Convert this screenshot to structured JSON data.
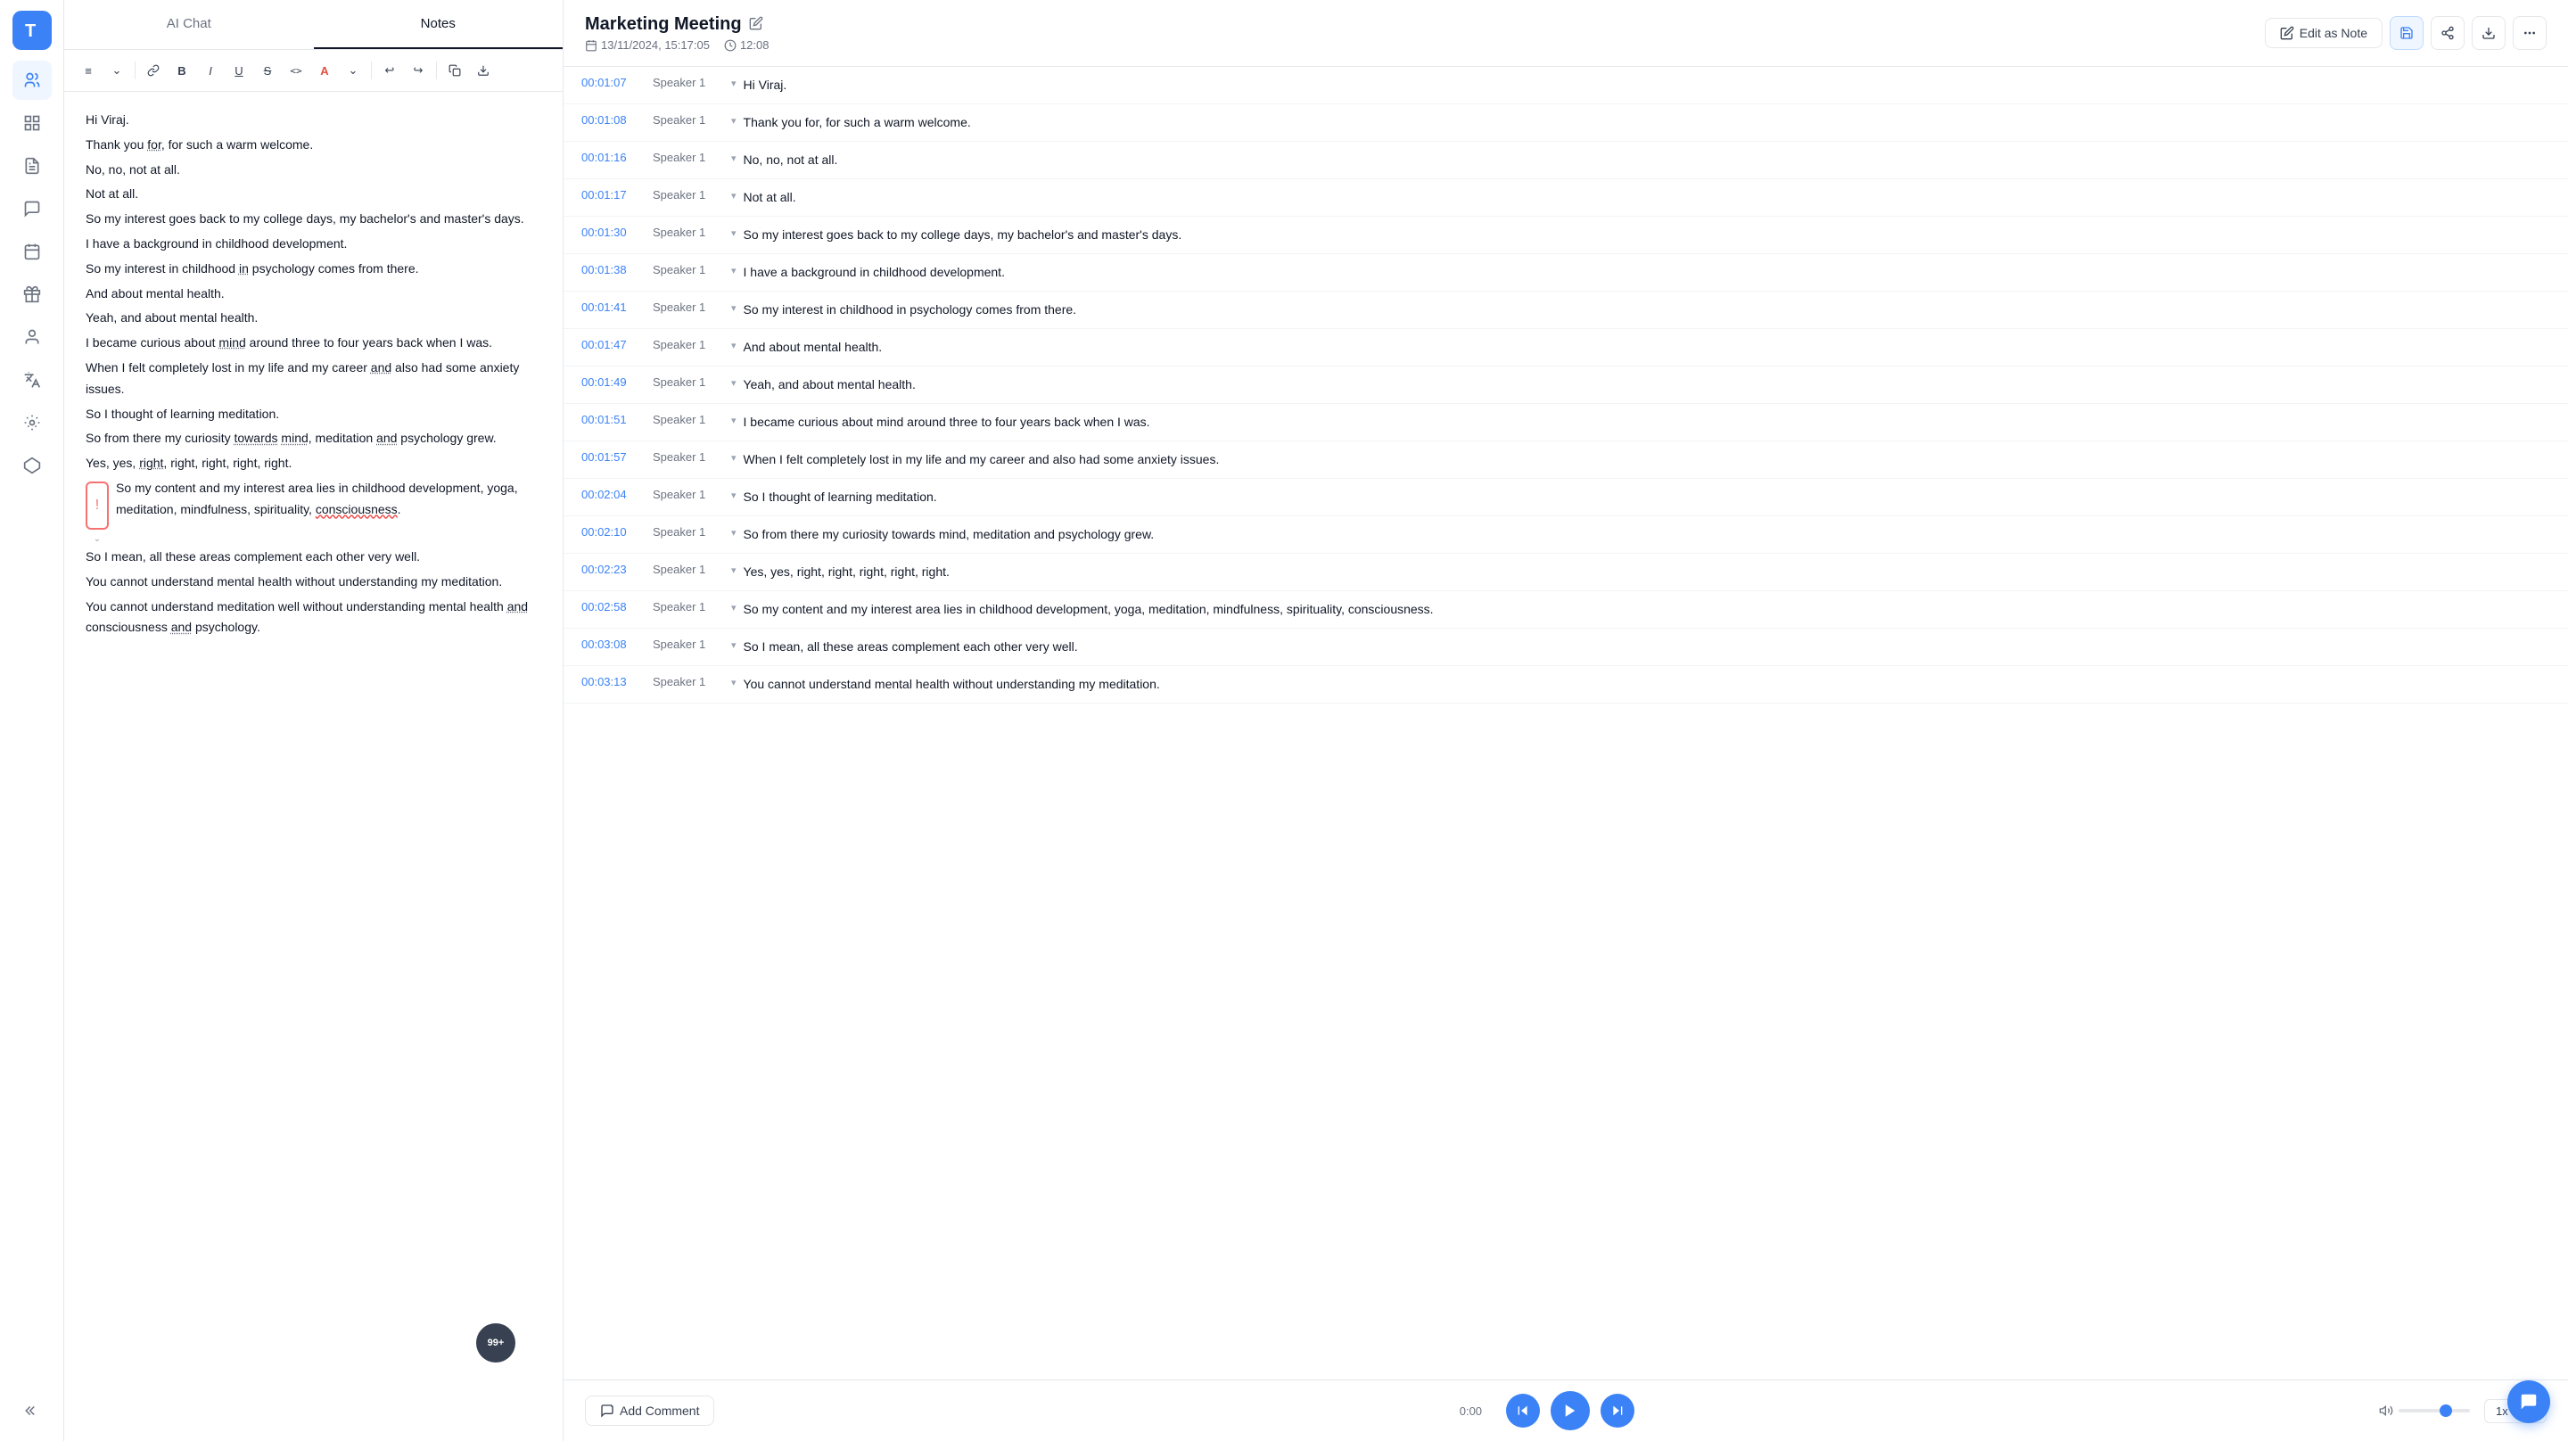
{
  "app": {
    "title": "Marketing Meeting"
  },
  "sidebar": {
    "logo_letter": "T",
    "items": [
      {
        "name": "users-icon",
        "label": "Users"
      },
      {
        "name": "grid-icon",
        "label": "Grid"
      },
      {
        "name": "document-icon",
        "label": "Document"
      },
      {
        "name": "chat-icon",
        "label": "Chat"
      },
      {
        "name": "calendar-icon",
        "label": "Calendar"
      },
      {
        "name": "gift-icon",
        "label": "Gift"
      },
      {
        "name": "person-icon",
        "label": "Person"
      },
      {
        "name": "translate-icon",
        "label": "Translate"
      },
      {
        "name": "tool-icon",
        "label": "Tool"
      },
      {
        "name": "diamond-icon",
        "label": "Diamond"
      }
    ]
  },
  "tabs": {
    "ai_chat": "AI Chat",
    "notes": "Notes"
  },
  "toolbar": {
    "buttons": [
      "≡",
      "⌄",
      "🔗",
      "B",
      "I",
      "U",
      "S",
      "<>",
      "A",
      "⌄",
      "↩",
      "↪",
      "⎘",
      "⬇"
    ]
  },
  "editor": {
    "lines": [
      "Hi Viraj.",
      "Thank you for, for such a warm welcome.",
      "No, no, not at all.",
      "Not at all.",
      "So my interest goes back to my college days, my bachelor's and master's days.",
      "I have a background in childhood development.",
      "So my interest in childhood in psychology comes from there.",
      "And about mental health.",
      "Yeah, and about mental health.",
      "I became curious about mind around three to four years back when I was.",
      "When I felt completely lost in my life and my career and also had some anxiety issues.",
      "So I thought of learning meditation.",
      "So from there my curiosity towards mind, meditation and psychology grew.",
      "Yes, yes, right, right, right, right, right.",
      "So my content and my interest area lies in childhood development, yoga, meditation, mindfulness, spirituality, consciousness.",
      "So I mean, all these areas complement each other very well.",
      "You cannot understand mental health without understanding my meditation.",
      "You cannot understand meditation well without understanding mental health and consciousness and psychology."
    ]
  },
  "meeting": {
    "title": "Marketing Meeting",
    "date": "13/11/2024, 15:17:05",
    "duration": "12:08",
    "edit_note_label": "Edit as Note"
  },
  "transcript": [
    {
      "time": "00:01:07",
      "speaker": "Speaker 1",
      "text": "Hi Viraj."
    },
    {
      "time": "00:01:08",
      "speaker": "Speaker 1",
      "text": "Thank you for, for such a warm welcome."
    },
    {
      "time": "00:01:16",
      "speaker": "Speaker 1",
      "text": "No, no, not at all."
    },
    {
      "time": "00:01:17",
      "speaker": "Speaker 1",
      "text": "Not at all."
    },
    {
      "time": "00:01:30",
      "speaker": "Speaker 1",
      "text": "So my interest goes back to my college days, my bachelor's and master's days."
    },
    {
      "time": "00:01:38",
      "speaker": "Speaker 1",
      "text": "I have a background in childhood development."
    },
    {
      "time": "00:01:41",
      "speaker": "Speaker 1",
      "text": "So my interest in childhood in psychology comes from there."
    },
    {
      "time": "00:01:47",
      "speaker": "Speaker 1",
      "text": "And about mental health."
    },
    {
      "time": "00:01:49",
      "speaker": "Speaker 1",
      "text": "Yeah, and about mental health."
    },
    {
      "time": "00:01:51",
      "speaker": "Speaker 1",
      "text": "I became curious about mind around three to four years back when I was."
    },
    {
      "time": "00:01:57",
      "speaker": "Speaker 1",
      "text": "When I felt completely lost in my life and my career and also had some anxiety issues."
    },
    {
      "time": "00:02:04",
      "speaker": "Speaker 1",
      "text": "So I thought of learning meditation."
    },
    {
      "time": "00:02:10",
      "speaker": "Speaker 1",
      "text": "So from there my curiosity towards mind, meditation and psychology grew."
    },
    {
      "time": "00:02:23",
      "speaker": "Speaker 1",
      "text": "Yes, yes, right, right, right, right, right."
    },
    {
      "time": "00:02:58",
      "speaker": "Speaker 1",
      "text": "So my content and my interest area lies in childhood development, yoga, meditation, mindfulness, spirituality, consciousness."
    },
    {
      "time": "00:03:08",
      "speaker": "Speaker 1",
      "text": "So I mean, all these areas complement each other very well."
    },
    {
      "time": "00:03:13",
      "speaker": "Speaker 1",
      "text": "You cannot understand mental health without understanding my meditation."
    }
  ],
  "player": {
    "current_time": "0:00",
    "add_comment": "Add Comment",
    "speed": "1x"
  },
  "badge": {
    "count": "99+"
  }
}
